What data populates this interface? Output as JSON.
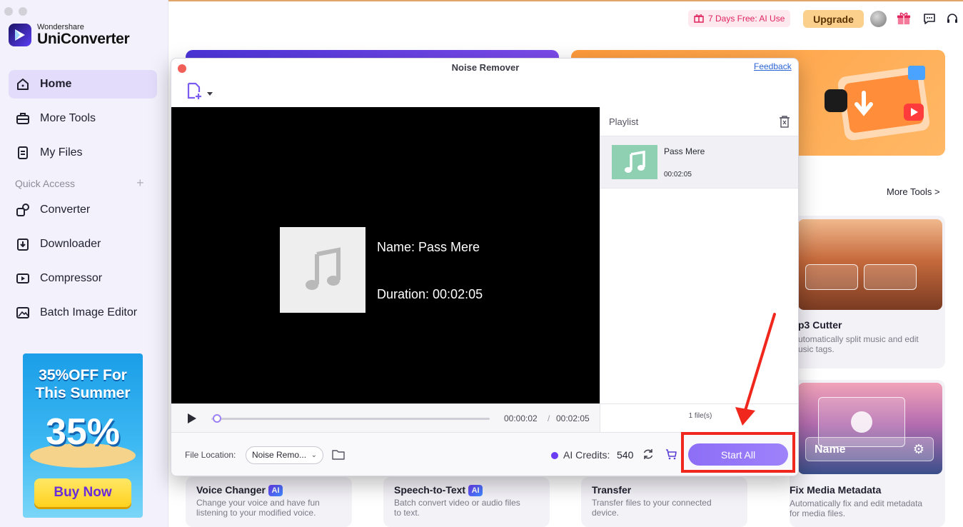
{
  "app": {
    "brand_small": "Wondershare",
    "brand_name": "UniConverter"
  },
  "sidebar": {
    "items": [
      {
        "label": "Home",
        "icon": "home-icon",
        "active": true
      },
      {
        "label": "More Tools",
        "icon": "toolbox-icon"
      },
      {
        "label": "My Files",
        "icon": "file-icon"
      }
    ],
    "quick_access_label": "Quick Access",
    "quick_items": [
      {
        "label": "Converter",
        "icon": "converter-icon"
      },
      {
        "label": "Downloader",
        "icon": "downloader-icon"
      },
      {
        "label": "Compressor",
        "icon": "compressor-icon"
      },
      {
        "label": "Batch Image Editor",
        "icon": "image-editor-icon"
      }
    ],
    "promo": {
      "title_line1": "35%OFF For",
      "title_line2": "This Summer",
      "big_text": "35%",
      "button": "Buy Now"
    }
  },
  "topbar": {
    "trial_label": "7 Days Free: AI Use",
    "upgrade_label": "Upgrade"
  },
  "main": {
    "more_tools_link": "More Tools >",
    "cards": [
      {
        "title": "Voice Changer",
        "ai": "AI",
        "desc1": "Change your voice and have fun",
        "desc2": "listening to your modified voice."
      },
      {
        "title": "Speech-to-Text",
        "ai": "AI",
        "desc1": "Batch convert video or audio files",
        "desc2": "to text."
      },
      {
        "title": "Transfer",
        "desc1": "Transfer files to your connected",
        "desc2": "device."
      },
      {
        "title": "Fix Media Metadata",
        "desc1": "Automatically fix and edit metadata",
        "desc2": "for media files."
      }
    ],
    "mp3_card": {
      "title": "p3 Cutter",
      "desc1": "utomatically split music and edit",
      "desc2": "usic tags."
    },
    "meta_thumb_label": "Name"
  },
  "dialog": {
    "title": "Noise Remover",
    "feedback": "Feedback",
    "player": {
      "name_text": "Name: Pass Mere",
      "duration_text": "Duration: 00:02:05",
      "current_time": "00:00:02",
      "separator": "/",
      "total_time": "00:02:05",
      "progress": 0.02
    },
    "playlist": {
      "header": "Playlist",
      "items": [
        {
          "name": "Pass Mere",
          "duration": "00:02:05"
        }
      ],
      "count_label": "1 file(s)"
    },
    "footer": {
      "file_location_label": "File Location:",
      "file_location_value": "Noise Remo...",
      "credits_label": "AI Credits:",
      "credits_value": "540",
      "start_all": "Start All"
    }
  },
  "colors": {
    "accent": "#8d6ef6",
    "annotation": "#f0271d",
    "sidebar_bg": "#f3f1fb",
    "active_item_bg": "#e4dcfb"
  }
}
